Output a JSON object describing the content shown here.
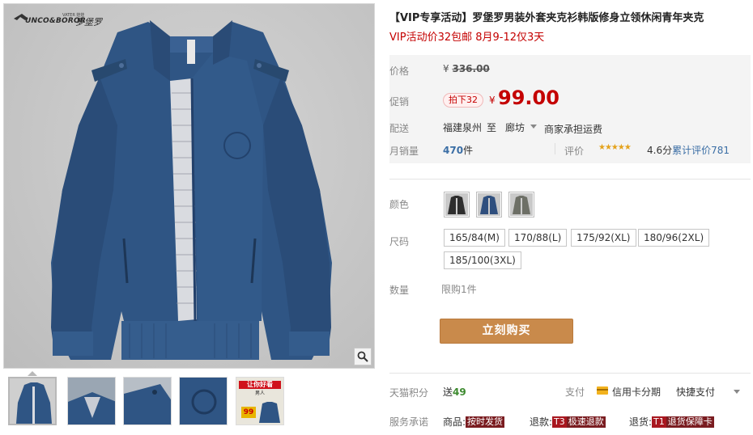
{
  "brand": {
    "name_en": "UNCO&BOROR",
    "name_small": "VATER 娃娃",
    "name_cn": "罗堡罗"
  },
  "gallery": {
    "zoom_icon": "magnifier-icon",
    "thumbnails": [
      {
        "alt": "jacket-front"
      },
      {
        "alt": "jacket-collar"
      },
      {
        "alt": "jacket-shoulder"
      },
      {
        "alt": "jacket-embroidery"
      },
      {
        "alt": "promo-banner",
        "line1": "让你好看",
        "line2": "男人",
        "price": "99"
      }
    ]
  },
  "product": {
    "title": "【VIP专享活动】罗堡罗男装外套夹克衫韩版修身立领休闲青年夹克",
    "subtitle": "VIP活动价32包邮 8月9-12仅3天"
  },
  "price": {
    "label": "价格",
    "currency": "¥",
    "original": "336.00"
  },
  "promotion": {
    "label": "促销",
    "tag": "拍下32",
    "currency": "¥",
    "price": "99.00"
  },
  "shipping": {
    "label": "配送",
    "from": "福建泉州",
    "to_word": "至",
    "destination": "廊坊",
    "fee_note": "商家承担运费"
  },
  "sales": {
    "label": "月销量",
    "count": "470",
    "unit": "件",
    "rating_label": "评价",
    "stars": "★★★★★",
    "score": 4.6,
    "score_text": "4.6分",
    "reviews_label": "累计评价",
    "reviews_count": "781"
  },
  "color": {
    "label": "颜色",
    "options": [
      {
        "name": "black",
        "hex": "#2e2e2e"
      },
      {
        "name": "blue",
        "hex": "#2f4f7e"
      },
      {
        "name": "grey",
        "hex": "#6d6f66"
      }
    ]
  },
  "size": {
    "label": "尺码",
    "options": [
      "165/84(M)",
      "170/88(L)",
      "175/92(XL)",
      "180/96(2XL)",
      "185/100(3XL)"
    ]
  },
  "quantity": {
    "label": "数量",
    "limit": "限购1件"
  },
  "buy_button": "立刻购买",
  "points": {
    "label": "天猫积分",
    "prefix": "送",
    "value": "49"
  },
  "payment": {
    "label": "支付",
    "credit_card": "信用卡分期",
    "quick_pay": "快捷支付"
  },
  "service": {
    "label": "服务承诺",
    "goods_label": "商品:",
    "goods_badge": "按时发货",
    "refund_label": "退款:",
    "refund_code": "T3",
    "refund_text": "极速退款",
    "return_label": "退货:",
    "return_code": "T1",
    "return_text": "退货保障卡"
  },
  "colors": {
    "accent_red": "#c40000",
    "buy_button": "#c98a4b",
    "link_blue": "#3b6ea5",
    "points_green": "#3d8a2f",
    "star_gold": "#e4a21b"
  }
}
